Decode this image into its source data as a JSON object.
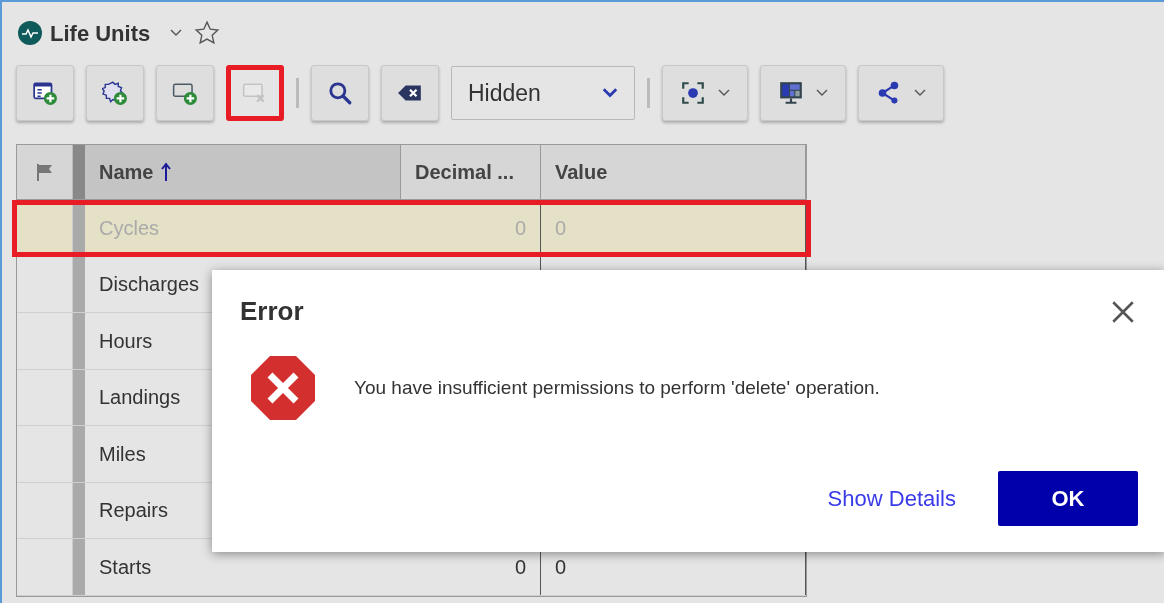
{
  "header": {
    "title": "Life Units",
    "favorite": false
  },
  "toolbar": [
    {
      "kind": "button",
      "disabled": false,
      "highlighted": false
    },
    {
      "kind": "button",
      "disabled": false,
      "highlighted": false
    },
    {
      "kind": "button",
      "disabled": false,
      "highlighted": false
    },
    {
      "kind": "button",
      "disabled": true,
      "highlighted": true
    },
    {
      "kind": "separator"
    },
    {
      "kind": "button",
      "disabled": false,
      "highlighted": false
    },
    {
      "kind": "button",
      "disabled": false,
      "highlighted": false
    },
    {
      "kind": "select",
      "value": "Hidden"
    },
    {
      "kind": "separator"
    },
    {
      "kind": "menu"
    },
    {
      "kind": "menu"
    },
    {
      "kind": "menu"
    }
  ],
  "table": {
    "columns": [
      "Name",
      "Decimal ...",
      "Value"
    ],
    "rows": [
      {
        "name": "Cycles",
        "decimal": "0",
        "value": "0",
        "disabled": true,
        "highlighted": true
      },
      {
        "name": "Discharges",
        "disabled": false,
        "highlighted": false
      },
      {
        "name": "Hours",
        "disabled": false,
        "highlighted": false
      },
      {
        "name": "Landings",
        "disabled": false,
        "highlighted": false
      },
      {
        "name": "Miles",
        "disabled": false,
        "highlighted": false
      },
      {
        "name": "Repairs",
        "disabled": false,
        "highlighted": false
      },
      {
        "name": "Starts",
        "decimal": "0",
        "value": "0",
        "disabled": false,
        "highlighted": false
      }
    ]
  },
  "dialog": {
    "title": "Error",
    "message": "You have insufficient permissions to perform 'delete' operation.",
    "buttons": [
      "Show Details",
      "OK"
    ]
  }
}
